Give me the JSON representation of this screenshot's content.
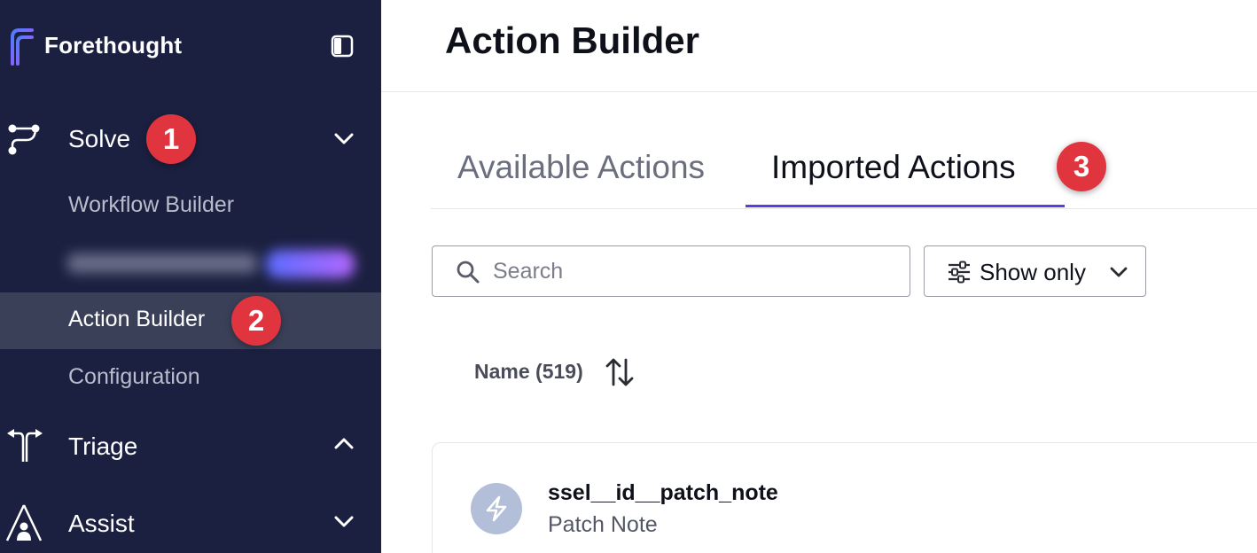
{
  "sidebar": {
    "brand": "Forethought",
    "sections": [
      {
        "label": "Solve",
        "icon": "route-icon",
        "state": "expanded"
      },
      {
        "label": "Triage",
        "icon": "fork-icon",
        "state": "collapsed"
      },
      {
        "label": "Assist",
        "icon": "person-triangle-icon",
        "state": "expanded"
      }
    ],
    "solve_items": [
      {
        "label": "Workflow Builder"
      },
      {
        "label": "Action Builder"
      },
      {
        "label": "Configuration"
      }
    ]
  },
  "annotations": {
    "badge1": "1",
    "badge2": "2",
    "badge3": "3"
  },
  "main": {
    "title": "Action Builder",
    "tabs": [
      {
        "label": "Available Actions",
        "active": false
      },
      {
        "label": "Imported Actions",
        "active": true
      }
    ],
    "search": {
      "placeholder": "Search",
      "value": ""
    },
    "filter": {
      "label": "Show only"
    },
    "table": {
      "column_header": "Name (519)"
    },
    "actions": [
      {
        "name": "ssel__id__patch_note",
        "display_name": "Patch Note",
        "icon": "lightning-icon"
      }
    ]
  },
  "colors": {
    "sidebar_bg": "#1b2040",
    "sidebar_active": "#3b4059",
    "accent": "#5a3fe0",
    "badge": "#e0353f"
  }
}
